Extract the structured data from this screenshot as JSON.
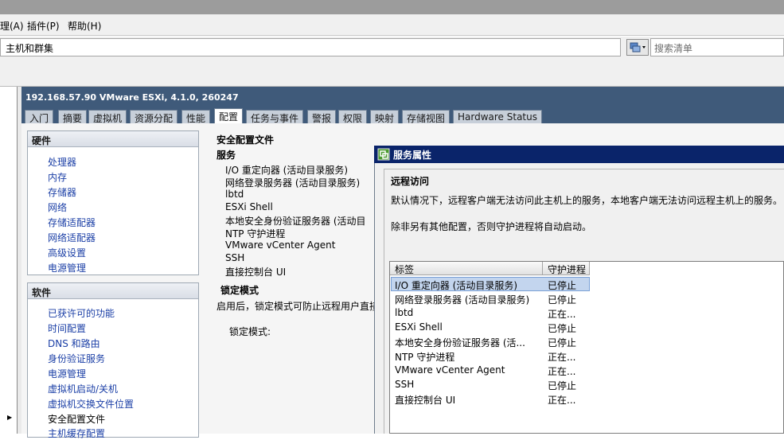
{
  "menu": {
    "items": [
      "理(A)",
      "插件(P)",
      "帮助(H)"
    ]
  },
  "address": {
    "path": "主机和群集",
    "search_placeholder": "搜索清单"
  },
  "host": {
    "title": "192.168.57.90 VMware ESXi, 4.1.0, 260247",
    "tabs": [
      "入门",
      "摘要",
      "虚拟机",
      "资源分配",
      "性能",
      "配置",
      "任务与事件",
      "警报",
      "权限",
      "映射",
      "存储视图",
      "Hardware Status"
    ],
    "active_tab": "配置"
  },
  "hardware": {
    "title": "硬件",
    "items": [
      "处理器",
      "内存",
      "存储器",
      "网络",
      "存储适配器",
      "网络适配器",
      "高级设置",
      "电源管理"
    ]
  },
  "software": {
    "title": "软件",
    "items": [
      "已获许可的功能",
      "时间配置",
      "DNS 和路由",
      "身份验证服务",
      "电源管理",
      "虚拟机启动/关机",
      "虚拟机交换文件位置",
      "安全配置文件",
      "主机缓存配置"
    ]
  },
  "security_profile": {
    "title": "安全配置文件",
    "services_title": "服务",
    "services": [
      "I/O 重定向器 (活动目录服务)",
      "网络登录服务器 (活动目录服务)",
      "lbtd",
      "ESXi Shell",
      "本地安全身份验证服务器 (活动目",
      "NTP 守护进程",
      "VMware vCenter Agent",
      "SSH",
      "直接控制台 UI"
    ],
    "lockdown_title": "锁定模式",
    "lockdown_desc": "启用后，锁定模式可防止远程用户直接",
    "lockdown_label": "锁定模式:"
  },
  "dialog": {
    "title": "服务属性",
    "section_title": "远程访问",
    "desc1": "默认情况下，远程客户端无法访问此主机上的服务，本地客户端无法访问远程主机上的服务。",
    "desc2": "除非另有其他配置，否则守护进程将自动启动。",
    "columns": [
      "标签",
      "守护进程"
    ],
    "rows": [
      {
        "label": "I/O 重定向器 (活动目录服务)",
        "status": "已停止"
      },
      {
        "label": "网络登录服务器 (活动目录服务)",
        "status": "已停止"
      },
      {
        "label": "lbtd",
        "status": "正在..."
      },
      {
        "label": "ESXi Shell",
        "status": "已停止"
      },
      {
        "label": "本地安全身份验证服务器 (活...",
        "status": "已停止"
      },
      {
        "label": "NTP 守护进程",
        "status": "正在..."
      },
      {
        "label": "VMware vCenter Agent",
        "status": "正在..."
      },
      {
        "label": "SSH",
        "status": "已停止"
      },
      {
        "label": "直接控制台 UI",
        "status": "正在..."
      }
    ]
  }
}
